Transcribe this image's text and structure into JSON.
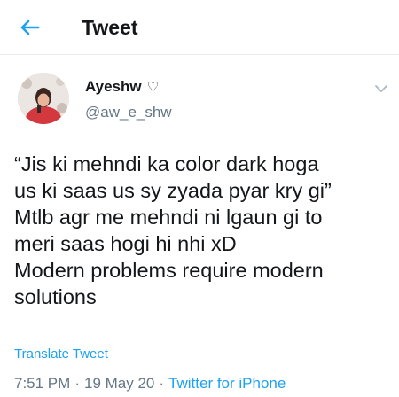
{
  "header": {
    "title": "Tweet"
  },
  "author": {
    "display_name": "Ayeshw",
    "name_emoji": "♡",
    "handle": "@aw_e_shw"
  },
  "tweet": {
    "lines": [
      "“Jis ki mehndi ka color dark hoga",
      "us ki saas us sy zyada pyar kry gi”",
      "Mtlb agr me mehndi ni lgaun gi to",
      "meri saas hogi hi nhi xD",
      "Modern problems require modern",
      "solutions"
    ],
    "translate_label": "Translate Tweet",
    "time": "7:51 PM",
    "separator": "·",
    "date": "19 May 20",
    "source": "Twitter for iPhone"
  },
  "colors": {
    "accent": "#1da1f2",
    "secondary_text": "#657786",
    "primary_text": "#14171a"
  }
}
